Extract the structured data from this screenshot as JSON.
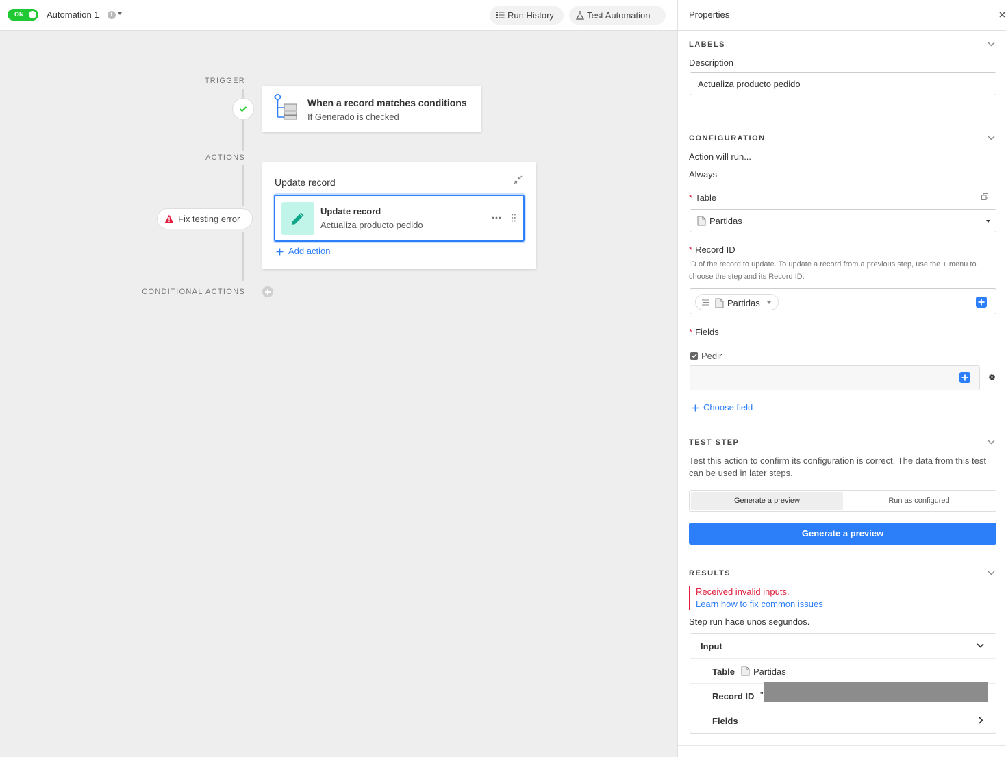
{
  "header": {
    "toggle_label": "ON",
    "automation_name": "Automation 1",
    "run_history_label": "Run History",
    "test_automation_label": "Test Automation"
  },
  "flow": {
    "trigger_label": "TRIGGER",
    "actions_label": "ACTIONS",
    "conditional_label": "CONDITIONAL ACTIONS",
    "trigger_card": {
      "title": "When a record matches conditions",
      "subtitle": "If Generado is checked"
    },
    "fix_error_label": "Fix testing error",
    "action_card": {
      "title": "Update record",
      "inner_title": "Update record",
      "inner_subtitle": "Actualiza producto pedido",
      "add_action_label": "Add action"
    }
  },
  "panel": {
    "title": "Properties",
    "labels_section": {
      "heading": "LABELS",
      "description_label": "Description",
      "description_value": "Actualiza producto pedido"
    },
    "configuration": {
      "heading": "CONFIGURATION",
      "action_will_run_label": "Action will run...",
      "action_will_run_value": "Always",
      "required_mark": "*",
      "table_label": "Table",
      "table_value": "Partidas",
      "record_id_label": "Record ID",
      "record_id_help": "ID of the record to update. To update a record from a previous step, use the + menu to choose the step and its Record ID.",
      "record_id_token": "Partidas",
      "fields_label": "Fields",
      "field_name": "Pedir",
      "choose_field_label": "Choose field"
    },
    "test_step": {
      "heading": "TEST STEP",
      "description": "Test this action to confirm its configuration is correct. The data from this test can be used in later steps.",
      "segment_preview": "Generate a preview",
      "segment_run": "Run as configured",
      "primary_button": "Generate a preview"
    },
    "results": {
      "heading": "RESULTS",
      "error_text": "Received invalid inputs.",
      "error_link": "Learn how to fix common issues",
      "step_run_text": "Step run hace unos segundos.",
      "input_label": "Input",
      "table_key": "Table",
      "table_value": "Partidas",
      "record_id_key": "Record ID",
      "record_id_quote": "\"",
      "fields_key": "Fields"
    }
  },
  "colors": {
    "toggle_on": "#20c933",
    "accent_blue": "#2d7ff9",
    "error_red": "#e0203e",
    "pencil_tile": "#c2f5e9",
    "canvas_bg": "#eeeeee"
  }
}
